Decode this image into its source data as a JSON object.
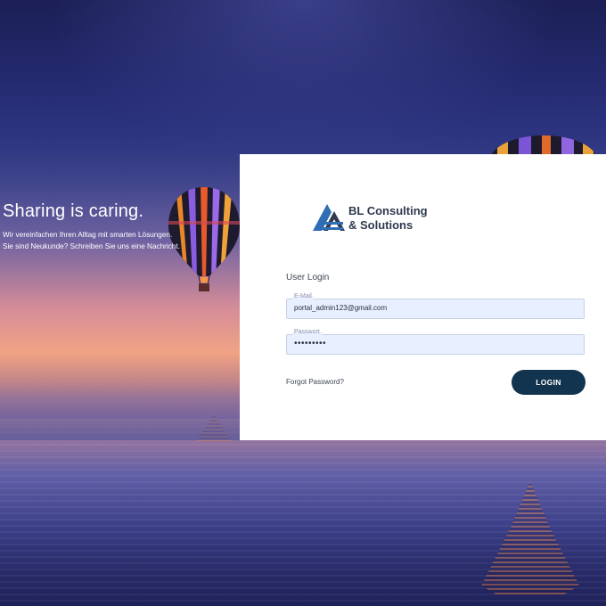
{
  "hero": {
    "headline": "Sharing is caring.",
    "subline_1": "Wir vereinfachen Ihren Alltag mit smarten Lösungen.",
    "subline_2": "Sie sind Neukunde? Schreiben Sie uns eine Nachricht."
  },
  "brand": {
    "line_1": "BL Consulting",
    "line_2": "& Solutions",
    "accent_color": "#2f6db5",
    "text_color": "#2f3a4f"
  },
  "login": {
    "title": "User Login",
    "email_label": "E-Mail",
    "email_value": "portal_admin123@gmail.com",
    "password_label": "Passwort",
    "password_value": "•••••••••",
    "forgot_link": "Forgot Password?",
    "button_label": "LOGIN",
    "button_color": "#12344f"
  }
}
